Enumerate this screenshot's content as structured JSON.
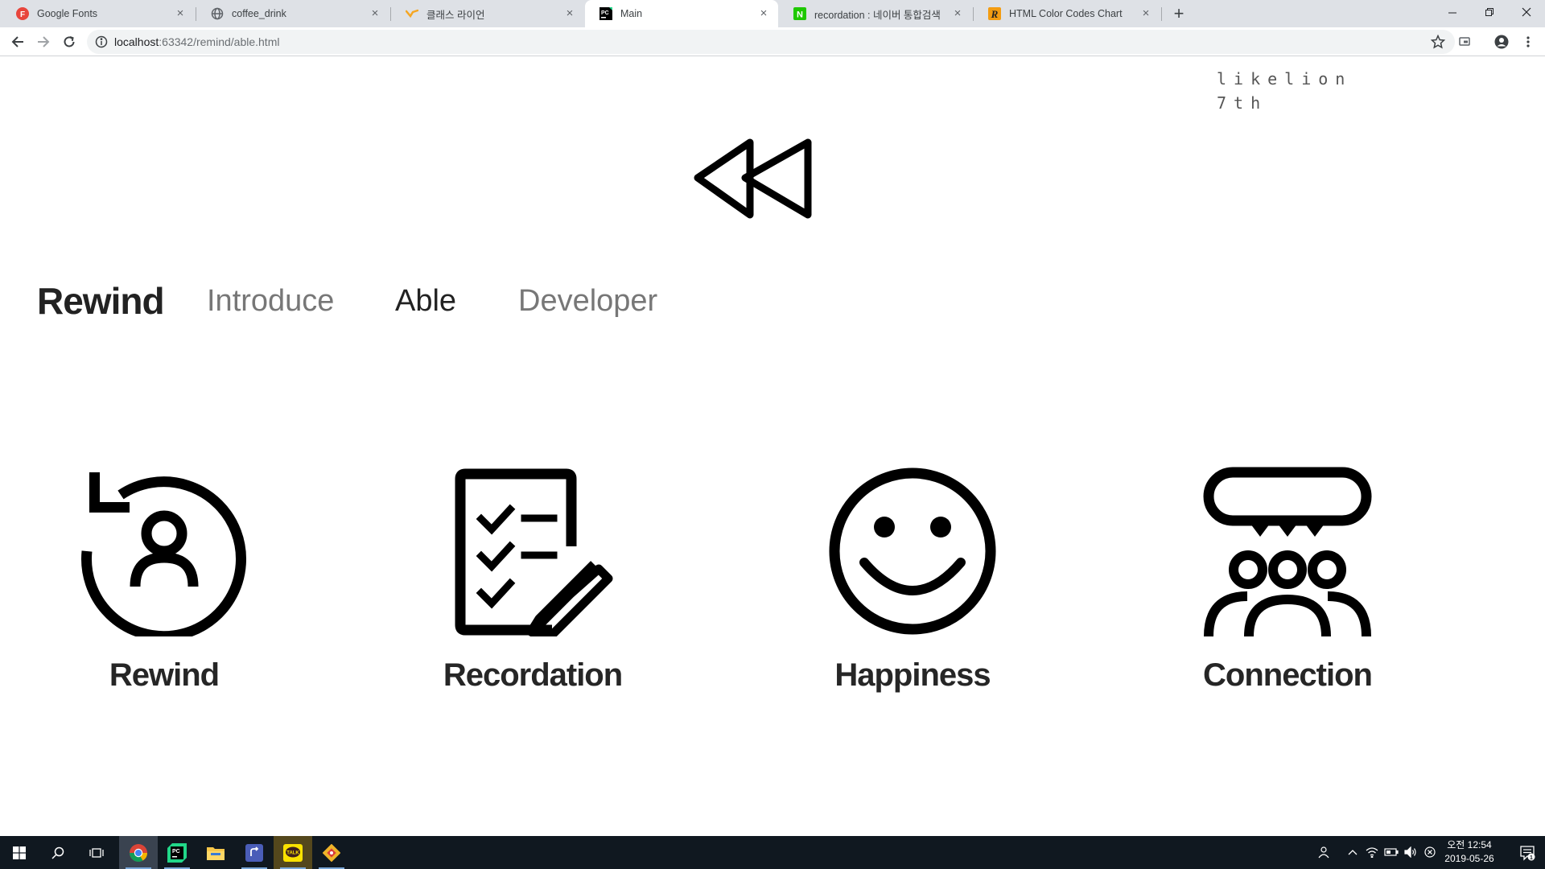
{
  "browser": {
    "tabs": [
      {
        "title": "Google Fonts",
        "icon": "google-fonts-icon"
      },
      {
        "title": "coffee_drink",
        "icon": "globe-icon"
      },
      {
        "title": "클래스 라이언",
        "icon": "likelion-icon"
      },
      {
        "title": "Main",
        "icon": "pycharm-icon",
        "active": true
      },
      {
        "title": "recordation : 네이버 통합검색",
        "icon": "naver-icon"
      },
      {
        "title": "HTML Color Codes Chart",
        "icon": "r-icon"
      }
    ],
    "url_host": "localhost",
    "url_rest": ":63342/remind/able.html"
  },
  "page": {
    "brand_note": [
      "likelion",
      "7th"
    ],
    "nav": {
      "brand": "Rewind",
      "items": [
        "Introduce",
        "Able",
        "Developer"
      ],
      "current": "Able"
    },
    "features": [
      {
        "label": "Rewind",
        "icon": "rewind-user-icon"
      },
      {
        "label": "Recordation",
        "icon": "checklist-pencil-icon"
      },
      {
        "label": "Happiness",
        "icon": "smiley-icon"
      },
      {
        "label": "Connection",
        "icon": "group-chat-icon"
      }
    ]
  },
  "taskbar": {
    "apps": [
      "chrome-icon",
      "pycharm-icon",
      "file-explorer-icon",
      "app-icon",
      "kakaotalk-icon",
      "git-icon"
    ],
    "kakao_label": "TALK",
    "clock_time": "오전 12:54",
    "clock_date": "2019-05-26",
    "notification_count": "1"
  },
  "colors": {
    "tabstrip": "#dee1e6",
    "taskbar": "#101820",
    "icon": "#000000",
    "text_dark": "#222222",
    "text_muted": "#777777"
  }
}
